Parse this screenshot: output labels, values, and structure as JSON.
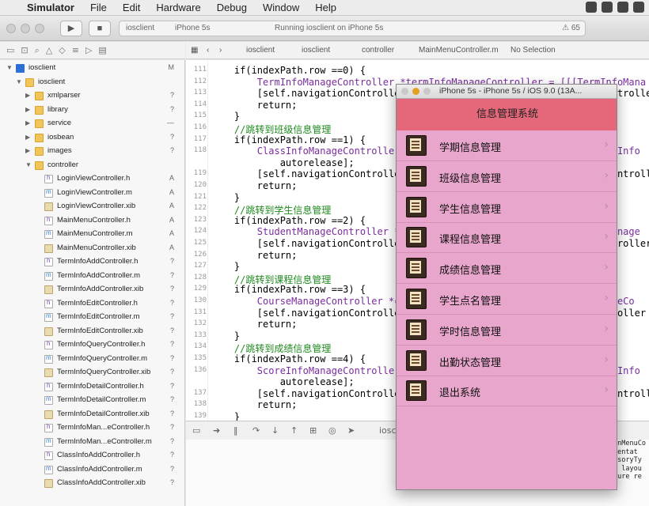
{
  "menubar": {
    "app": "Simulator",
    "items": [
      "File",
      "Edit",
      "Hardware",
      "Debug",
      "Window",
      "Help"
    ]
  },
  "toolbar": {
    "scheme_project": "iosclient",
    "scheme_device": "iPhone 5s",
    "status": "Running iosclient on iPhone 5s",
    "warning_count": "65"
  },
  "jumpbar": {
    "items": [
      "iosclient",
      "iosclient",
      "controller",
      "MainMenuController.m",
      "No Selection"
    ]
  },
  "navigator": {
    "rows": [
      {
        "indent": 0,
        "type": "proj",
        "name": "iosclient",
        "status": "M",
        "open": true
      },
      {
        "indent": 1,
        "type": "folder",
        "name": "iosclient",
        "status": "",
        "open": true
      },
      {
        "indent": 2,
        "type": "folder",
        "name": "xmlparser",
        "status": "?",
        "open": false
      },
      {
        "indent": 2,
        "type": "folder",
        "name": "library",
        "status": "?",
        "open": false
      },
      {
        "indent": 2,
        "type": "folder",
        "name": "service",
        "status": "—",
        "open": false
      },
      {
        "indent": 2,
        "type": "folder",
        "name": "iosbean",
        "status": "?",
        "open": false
      },
      {
        "indent": 2,
        "type": "folder",
        "name": "images",
        "status": "?",
        "open": false
      },
      {
        "indent": 2,
        "type": "folder",
        "name": "controller",
        "status": "",
        "open": true
      },
      {
        "indent": 3,
        "type": "hfile",
        "name": "LoginViewController.h",
        "status": "A"
      },
      {
        "indent": 3,
        "type": "mfile",
        "name": "LoginViewController.m",
        "status": "A"
      },
      {
        "indent": 3,
        "type": "xib",
        "name": "LoginViewController.xib",
        "status": "A"
      },
      {
        "indent": 3,
        "type": "hfile",
        "name": "MainMenuController.h",
        "status": "A"
      },
      {
        "indent": 3,
        "type": "mfile",
        "name": "MainMenuController.m",
        "status": "A"
      },
      {
        "indent": 3,
        "type": "xib",
        "name": "MainMenuController.xib",
        "status": "A"
      },
      {
        "indent": 3,
        "type": "hfile",
        "name": "TermInfoAddController.h",
        "status": "?"
      },
      {
        "indent": 3,
        "type": "mfile",
        "name": "TermInfoAddController.m",
        "status": "?"
      },
      {
        "indent": 3,
        "type": "xib",
        "name": "TermInfoAddController.xib",
        "status": "?"
      },
      {
        "indent": 3,
        "type": "hfile",
        "name": "TermInfoEditController.h",
        "status": "?"
      },
      {
        "indent": 3,
        "type": "mfile",
        "name": "TermInfoEditController.m",
        "status": "?"
      },
      {
        "indent": 3,
        "type": "xib",
        "name": "TermInfoEditController.xib",
        "status": "?"
      },
      {
        "indent": 3,
        "type": "hfile",
        "name": "TermInfoQueryController.h",
        "status": "?"
      },
      {
        "indent": 3,
        "type": "mfile",
        "name": "TermInfoQueryController.m",
        "status": "?"
      },
      {
        "indent": 3,
        "type": "xib",
        "name": "TermInfoQueryController.xib",
        "status": "?"
      },
      {
        "indent": 3,
        "type": "hfile",
        "name": "TermInfoDetailController.h",
        "status": "?"
      },
      {
        "indent": 3,
        "type": "mfile",
        "name": "TermInfoDetailController.m",
        "status": "?"
      },
      {
        "indent": 3,
        "type": "xib",
        "name": "TermInfoDetailController.xib",
        "status": "?"
      },
      {
        "indent": 3,
        "type": "hfile",
        "name": "TermInfoMan...eController.h",
        "status": "?"
      },
      {
        "indent": 3,
        "type": "mfile",
        "name": "TermInfoMan...eController.m",
        "status": "?"
      },
      {
        "indent": 3,
        "type": "hfile",
        "name": "ClassInfoAddController.h",
        "status": "?"
      },
      {
        "indent": 3,
        "type": "mfile",
        "name": "ClassInfoAddController.m",
        "status": "?"
      },
      {
        "indent": 3,
        "type": "xib",
        "name": "ClassInfoAddController.xib",
        "status": "?"
      }
    ]
  },
  "code": {
    "lines": [
      {
        "n": "111",
        "t": "    if(indexPath.row ==0) {",
        "c": ""
      },
      {
        "n": "112",
        "t": "        TermInfoManageController *termInfoManageController = [[[TermInfoMana",
        "c": "dk"
      },
      {
        "n": "113",
        "t": "        [self.navigationController pushViewController:termInfoManageController",
        "c": ""
      },
      {
        "n": "114",
        "t": "        return;",
        "c": ""
      },
      {
        "n": "115",
        "t": "    }",
        "c": ""
      },
      {
        "n": "116",
        "t": "    //跳转到班级信息管理",
        "c": "cm"
      },
      {
        "n": "117",
        "t": "    if(indexPath.row ==1) {",
        "c": ""
      },
      {
        "n": "118",
        "t": "        ClassInfoManageController *classInfoManageController = [[[ClassInfo",
        "c": "dk"
      },
      {
        "n": "",
        "t": "            autorelease];",
        "c": ""
      },
      {
        "n": "119",
        "t": "        [self.navigationController pushViewController:classInfoManageController",
        "c": ""
      },
      {
        "n": "120",
        "t": "        return;",
        "c": ""
      },
      {
        "n": "121",
        "t": "    }",
        "c": ""
      },
      {
        "n": "122",
        "t": "    //跳转到学生信息管理",
        "c": "cm"
      },
      {
        "n": "123",
        "t": "    if(indexPath.row ==2) {",
        "c": ""
      },
      {
        "n": "124",
        "t": "        StudentManageController *studentManageController = [[[StudentManage",
        "c": "dk"
      },
      {
        "n": "125",
        "t": "        [self.navigationController pushViewController:studentManageController",
        "c": ""
      },
      {
        "n": "126",
        "t": "        return;",
        "c": ""
      },
      {
        "n": "127",
        "t": "    }",
        "c": ""
      },
      {
        "n": "128",
        "t": "    //跳转到课程信息管理",
        "c": "cm"
      },
      {
        "n": "129",
        "t": "    if(indexPath.row ==3) {",
        "c": ""
      },
      {
        "n": "130",
        "t": "        CourseManageController *courseManageController = [[[CourseManageCo",
        "c": "dk"
      },
      {
        "n": "131",
        "t": "        [self.navigationController pushViewController:courseManageController",
        "c": ""
      },
      {
        "n": "132",
        "t": "        return;",
        "c": ""
      },
      {
        "n": "133",
        "t": "    }",
        "c": ""
      },
      {
        "n": "134",
        "t": "    //跳转到成绩信息管理",
        "c": "cm"
      },
      {
        "n": "135",
        "t": "    if(indexPath.row ==4) {",
        "c": ""
      },
      {
        "n": "136",
        "t": "        ScoreInfoManageController *scoreInfoManageController = [[[ScoreInfo",
        "c": "dk"
      },
      {
        "n": "",
        "t": "            autorelease];",
        "c": ""
      },
      {
        "n": "137",
        "t": "        [self.navigationController pushViewController:scoreInfoManageController",
        "c": ""
      },
      {
        "n": "138",
        "t": "        return;",
        "c": ""
      },
      {
        "n": "139",
        "t": "    }",
        "c": ""
      }
    ]
  },
  "debugbar": {
    "target": "iosclient"
  },
  "console": {
    "text": "enMenuCo\nmentat\nssoryTy\n  layou\nture re"
  },
  "simulator": {
    "window_title": "iPhone 5s - iPhone 5s / iOS 9.0 (13A...",
    "nav_title": "信息管理系统",
    "items": [
      {
        "label": "学期信息管理",
        "chevron": "›"
      },
      {
        "label": "班级信息管理",
        "chevron": "›"
      },
      {
        "label": "学生信息管理",
        "chevron": "›"
      },
      {
        "label": "课程信息管理",
        "chevron": "›"
      },
      {
        "label": "成绩信息管理",
        "chevron": "›"
      },
      {
        "label": "学生点名管理",
        "chevron": "›"
      },
      {
        "label": "学时信息管理",
        "chevron": "›"
      },
      {
        "label": "出勤状态管理",
        "chevron": "›"
      },
      {
        "label": "退出系统",
        "chevron": "›"
      }
    ]
  }
}
